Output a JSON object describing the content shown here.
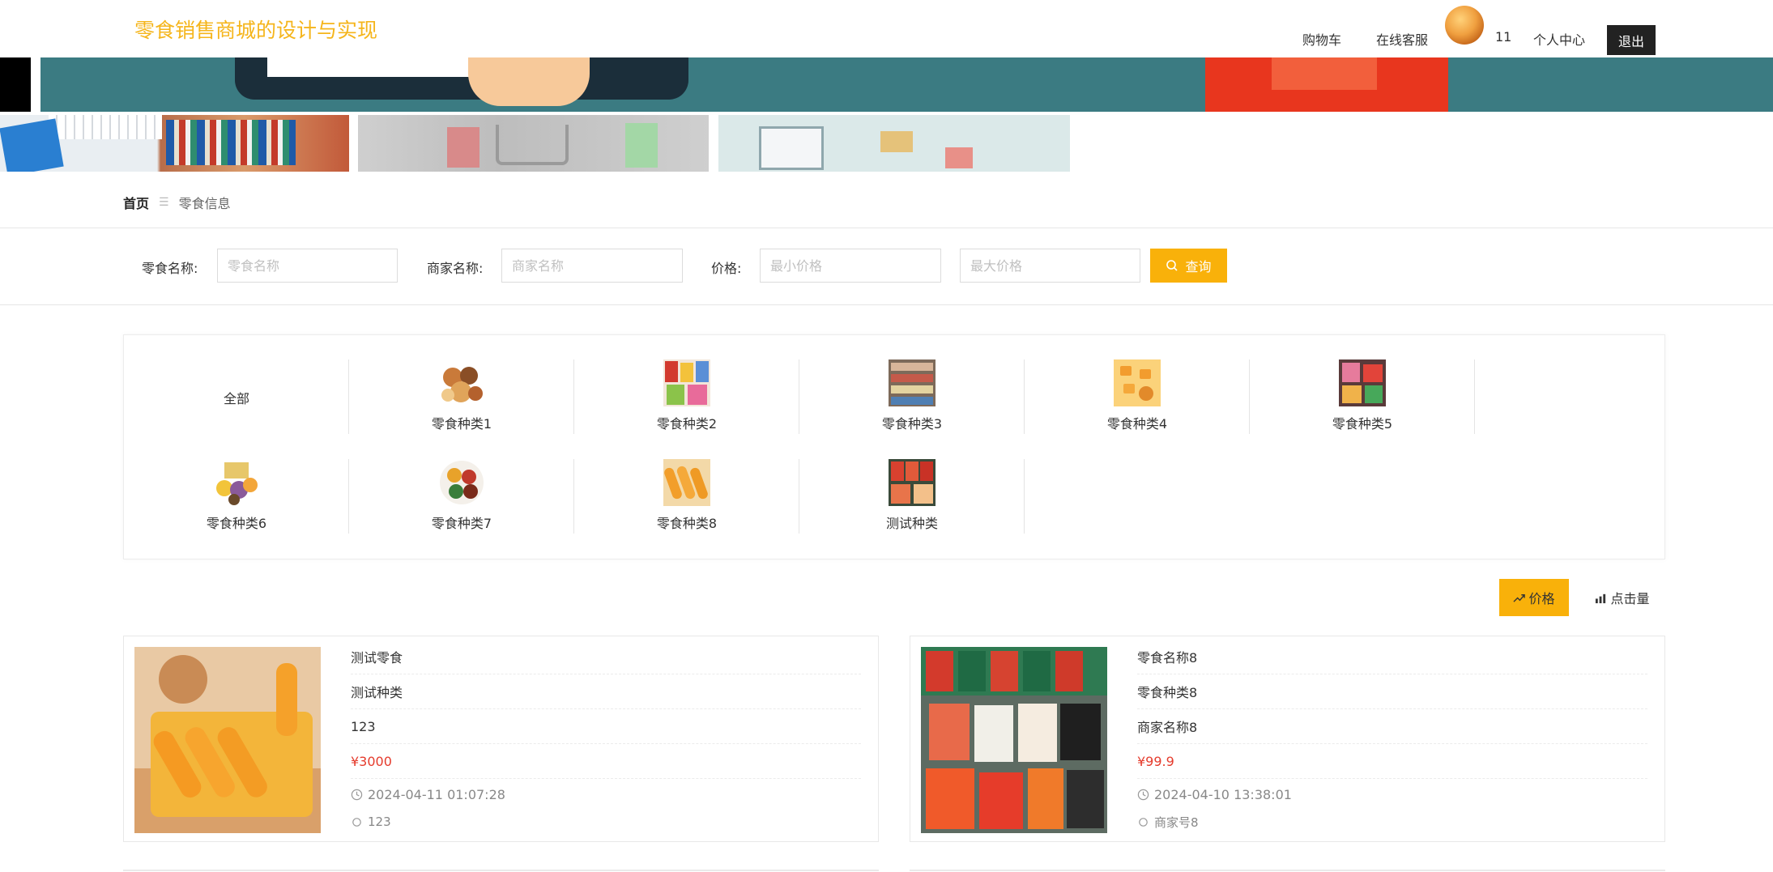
{
  "header": {
    "site_title": "零食销售商城的设计与实现",
    "nav": {
      "cart": "购物车",
      "service": "在线客服",
      "username": "11",
      "profile": "个人中心",
      "logout": "退出"
    }
  },
  "breadcrumb": {
    "home": "首页",
    "separator": "☰",
    "current": "零食信息"
  },
  "search": {
    "name_label": "零食名称:",
    "name_placeholder": "零食名称",
    "merchant_label": "商家名称:",
    "merchant_placeholder": "商家名称",
    "price_label": "价格:",
    "min_price_placeholder": "最小价格",
    "max_price_placeholder": "最大价格",
    "button": "查询"
  },
  "categories": [
    {
      "name": "全部"
    },
    {
      "name": "零食种类1"
    },
    {
      "name": "零食种类2"
    },
    {
      "name": "零食种类3"
    },
    {
      "name": "零食种类4"
    },
    {
      "name": "零食种类5"
    },
    {
      "name": "零食种类6"
    },
    {
      "name": "零食种类7"
    },
    {
      "name": "零食种类8"
    },
    {
      "name": "测试种类"
    }
  ],
  "sort": {
    "price": "价格",
    "clicks": "点击量"
  },
  "products": [
    {
      "name": "测试零食",
      "category": "测试种类",
      "merchant": "123",
      "price": "¥3000",
      "time": "2024-04-11 01:07:28",
      "author": "123"
    },
    {
      "name": "零食名称8",
      "category": "零食种类8",
      "merchant": "商家名称8",
      "price": "¥99.9",
      "time": "2024-04-10 13:38:01",
      "author": "商家号8"
    }
  ],
  "colors": {
    "brand": "#f5b51b",
    "button": "#f9b10a",
    "price": "#e53b2c",
    "logout_bg": "#222222"
  }
}
